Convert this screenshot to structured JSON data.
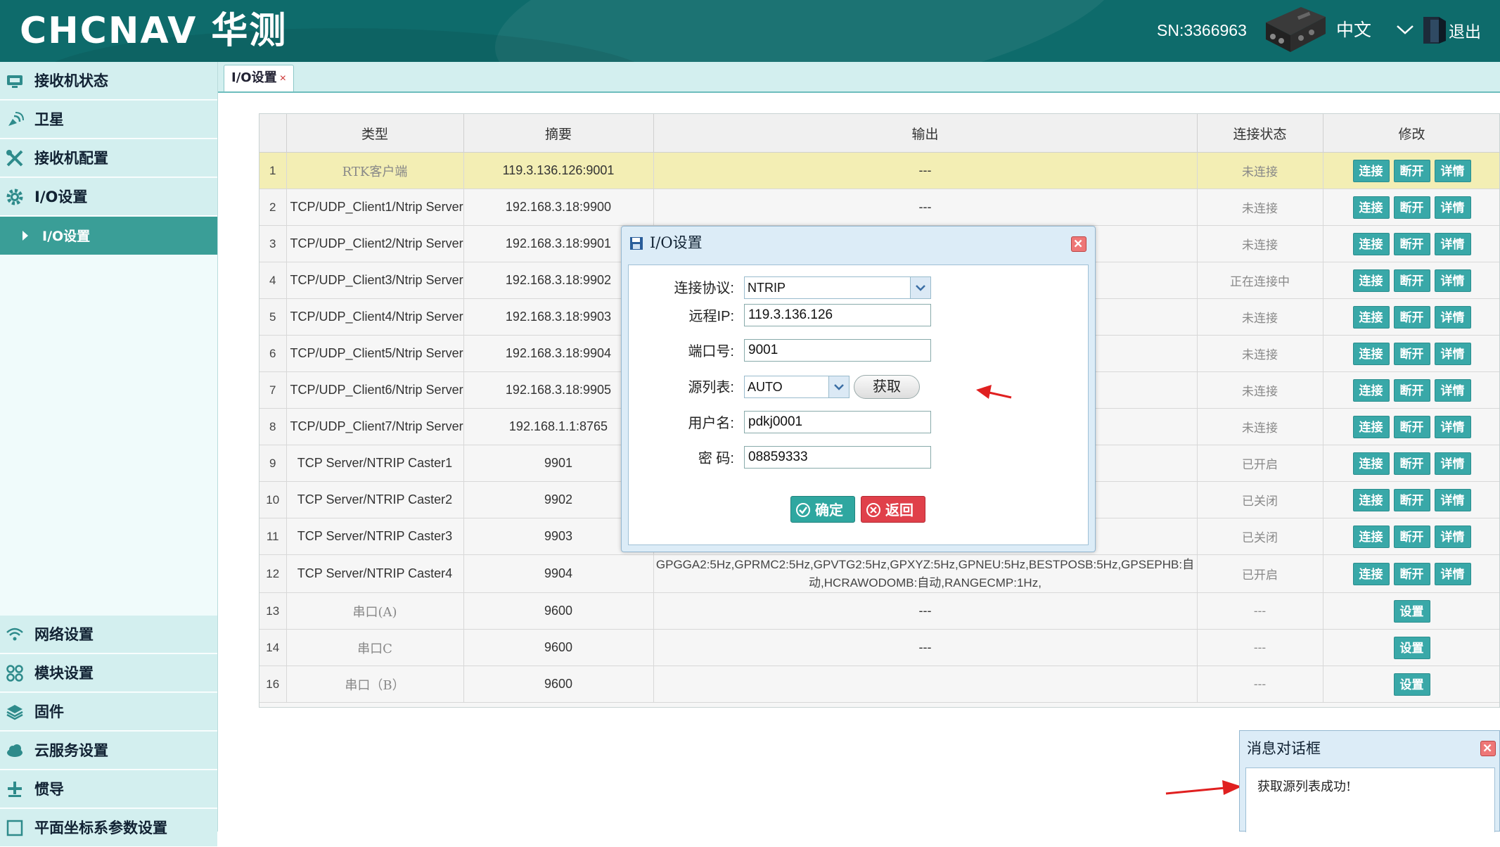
{
  "header": {
    "logo": "CHCNAV 华测",
    "serial": "SN:3366963",
    "language": "中文",
    "exit_label": "退出"
  },
  "sidebar": {
    "items_top": [
      {
        "label": "接收机状态",
        "icon": "monitor-icon"
      },
      {
        "label": "卫星",
        "icon": "satellite-icon"
      },
      {
        "label": "接收机配置",
        "icon": "tools-icon"
      },
      {
        "label": "I/O设置",
        "icon": "gear-icon"
      }
    ],
    "sub_item": "I/O设置",
    "items_bottom": [
      {
        "label": "网络设置",
        "icon": "wifi-icon"
      },
      {
        "label": "模块设置",
        "icon": "modules-icon"
      },
      {
        "label": "固件",
        "icon": "layers-icon"
      },
      {
        "label": "云服务设置",
        "icon": "cloud-icon"
      },
      {
        "label": "惯导",
        "icon": "antenna-icon"
      },
      {
        "label": "平面坐标系参数设置",
        "icon": "grid-icon"
      }
    ]
  },
  "tab": {
    "label": "I/O设置",
    "close": "×"
  },
  "table": {
    "headers": [
      "类型",
      "摘要",
      "输出",
      "连接状态",
      "修改"
    ],
    "rows": [
      {
        "n": "1",
        "type": "RTK客户端",
        "summary": "119.3.136.126:9001",
        "output": "---",
        "status": "未连接",
        "actions": [
          "连接",
          "断开",
          "详情"
        ]
      },
      {
        "n": "2",
        "type": "TCP/UDP_Client1/Ntrip Server",
        "summary": "192.168.3.18:9900",
        "output": "---",
        "status": "未连接",
        "actions": [
          "连接",
          "断开",
          "详情"
        ]
      },
      {
        "n": "3",
        "type": "TCP/UDP_Client2/Ntrip Server",
        "summary": "192.168.3.18:9901",
        "output": "",
        "status": "未连接",
        "actions": [
          "连接",
          "断开",
          "详情"
        ]
      },
      {
        "n": "4",
        "type": "TCP/UDP_Client3/Ntrip Server",
        "summary": "192.168.3.18:9902",
        "output": "",
        "status": "正在连接中",
        "actions": [
          "连接",
          "断开",
          "详情"
        ]
      },
      {
        "n": "5",
        "type": "TCP/UDP_Client4/Ntrip Server",
        "summary": "192.168.3.18:9903",
        "output": "",
        "status": "未连接",
        "actions": [
          "连接",
          "断开",
          "详情"
        ]
      },
      {
        "n": "6",
        "type": "TCP/UDP_Client5/Ntrip Server",
        "summary": "192.168.3.18:9904",
        "output": "",
        "status": "未连接",
        "actions": [
          "连接",
          "断开",
          "详情"
        ]
      },
      {
        "n": "7",
        "type": "TCP/UDP_Client6/Ntrip Server",
        "summary": "192.168.3.18:9905",
        "output": "",
        "status": "未连接",
        "actions": [
          "连接",
          "断开",
          "详情"
        ]
      },
      {
        "n": "8",
        "type": "TCP/UDP_Client7/Ntrip Server",
        "summary": "192.168.1.1:8765",
        "output": "",
        "status": "未连接",
        "actions": [
          "连接",
          "断开",
          "详情"
        ]
      },
      {
        "n": "9",
        "type": "TCP Server/NTRIP Caster1",
        "summary": "9901",
        "output": "",
        "status": "已开启",
        "actions": [
          "连接",
          "断开",
          "详情"
        ]
      },
      {
        "n": "10",
        "type": "TCP Server/NTRIP Caster2",
        "summary": "9902",
        "output": "",
        "status": "已关闭",
        "actions": [
          "连接",
          "断开",
          "详情"
        ]
      },
      {
        "n": "11",
        "type": "TCP Server/NTRIP Caster3",
        "summary": "9903",
        "output": "",
        "status": "已关闭",
        "actions": [
          "连接",
          "断开",
          "详情"
        ]
      },
      {
        "n": "12",
        "type": "TCP Server/NTRIP Caster4",
        "summary": "9904",
        "output": "GPGGA2:5Hz,GPRMC2:5Hz,GPVTG2:5Hz,GPXYZ:5Hz,GPNEU:5Hz,BESTPOSB:5Hz,GPSEPHB:自动,HCRAWODOMB:自动,RANGECMP:1Hz,",
        "status": "已开启",
        "actions": [
          "连接",
          "断开",
          "详情"
        ]
      },
      {
        "n": "13",
        "type": "串口(A)",
        "summary": "9600",
        "output": "---",
        "status": "---",
        "actions": [
          "设置"
        ]
      },
      {
        "n": "14",
        "type": "串口C",
        "summary": "9600",
        "output": "---",
        "status": "---",
        "actions": [
          "设置"
        ]
      },
      {
        "n": "16",
        "type": "串口（B）",
        "summary": "9600",
        "output": "",
        "status": "---",
        "actions": [
          "设置"
        ]
      }
    ]
  },
  "dialog": {
    "title": "I/O设置",
    "fields": {
      "protocol_label": "连接协议:",
      "protocol_value": "NTRIP",
      "ip_label": "远程IP:",
      "ip_value": "119.3.136.126",
      "port_label": "端口号:",
      "port_value": "9001",
      "source_label": "源列表:",
      "source_value": "AUTO",
      "fetch_label": "获取",
      "user_label": "用户名:",
      "user_value": "pdkj0001",
      "password_label": "密 码:",
      "password_value": "08859333"
    },
    "ok_label": "确定",
    "back_label": "返回"
  },
  "message": {
    "title": "消息对话框",
    "text": "获取源列表成功!"
  },
  "colors": {
    "header_bg": "#0e6b6b",
    "accent": "#39a8a8",
    "selected_row": "#f3eeb4",
    "sidebar_active": "#3a9e97",
    "annotation_arrow": "#e02020"
  }
}
